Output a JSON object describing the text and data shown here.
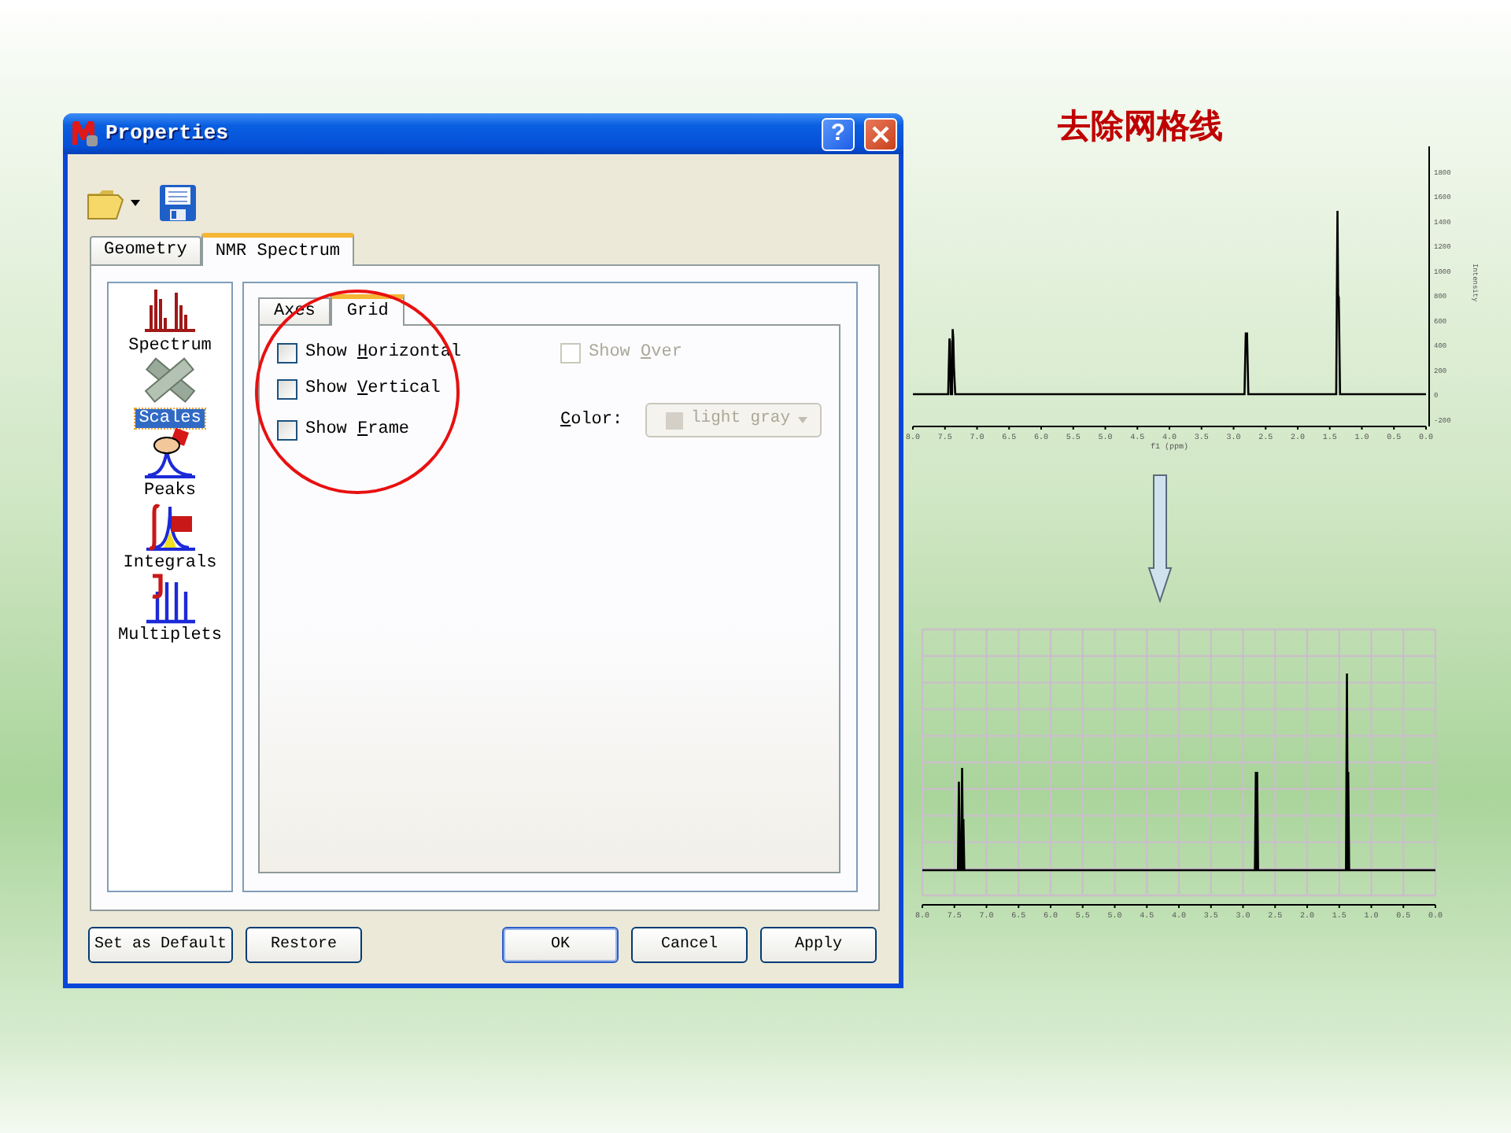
{
  "slide_title": "去除网格线",
  "dialog": {
    "title": "Properties",
    "help_label": "?",
    "tabs": [
      {
        "label": "Geometry",
        "selected": false
      },
      {
        "label": "NMR Spectrum",
        "selected": true
      }
    ],
    "categories": [
      {
        "label": "Spectrum",
        "kind": "spectrum",
        "selected": false
      },
      {
        "label": "Scales",
        "kind": "scales",
        "selected": true
      },
      {
        "label": "Peaks",
        "kind": "peaks",
        "selected": false
      },
      {
        "label": "Integrals",
        "kind": "integrals",
        "selected": false
      },
      {
        "label": "Multiplets",
        "kind": "multiplets",
        "selected": false
      }
    ],
    "subtabs": [
      {
        "label": "Axes",
        "selected": false
      },
      {
        "label": "Grid",
        "selected": true
      }
    ],
    "grid_options": [
      {
        "before": "Show ",
        "key": "H",
        "after": "orizontal",
        "checked": false,
        "disabled": false
      },
      {
        "before": "Show ",
        "key": "V",
        "after": "ertical",
        "checked": false,
        "disabled": false
      },
      {
        "before": "Show ",
        "key": "F",
        "after": "rame",
        "checked": false,
        "disabled": false
      }
    ],
    "over_option": {
      "before": "Show ",
      "key": "O",
      "after": "ver",
      "checked": false,
      "disabled": true
    },
    "color_field": {
      "key": "C",
      "after": "olor:",
      "value": "light gray",
      "disabled": true
    },
    "left_buttons": [
      {
        "label": "Set as Default",
        "default": false
      },
      {
        "label": "Restore",
        "default": false
      }
    ],
    "right_buttons": [
      {
        "label": "OK",
        "default": true
      },
      {
        "label": "Cancel",
        "default": false
      },
      {
        "label": "Apply",
        "default": false
      }
    ]
  },
  "spectrum_before": {
    "grid": false,
    "chart_data": {
      "type": "line",
      "xlabel": "f1 (ppm)",
      "ylabel": "Intensity",
      "x": [
        8.0,
        7.45,
        7.43,
        7.42,
        7.41,
        7.39,
        7.38,
        7.37,
        7.36,
        7.34,
        2.83,
        2.81,
        2.8,
        2.79,
        2.77,
        1.4,
        1.39,
        1.38,
        1.37,
        1.36,
        1.34,
        0.0
      ],
      "series": [
        {
          "color": "#000000",
          "values": [
            0,
            0,
            450,
            420,
            0,
            0,
            525,
            450,
            220,
            0,
            0,
            490,
            490,
            490,
            0,
            0,
            800,
            1480,
            800,
            780,
            0,
            0
          ]
        }
      ],
      "xlim": [
        8.0,
        0.0
      ],
      "ylim": [
        -260,
        2000
      ],
      "xticks": [
        {
          "value": 8.0,
          "label": "8.0"
        },
        {
          "value": 7.5,
          "label": "7.5"
        },
        {
          "value": 7.0,
          "label": "7.0"
        },
        {
          "value": 6.5,
          "label": "6.5"
        },
        {
          "value": 6.0,
          "label": "6.0"
        },
        {
          "value": 5.5,
          "label": "5.5"
        },
        {
          "value": 5.0,
          "label": "5.0"
        },
        {
          "value": 4.5,
          "label": "4.5"
        },
        {
          "value": 4.0,
          "label": "4.0"
        },
        {
          "value": 3.5,
          "label": "3.5"
        },
        {
          "value": 3.0,
          "label": "3.0"
        },
        {
          "value": 2.5,
          "label": "2.5"
        },
        {
          "value": 2.0,
          "label": "2.0"
        },
        {
          "value": 1.5,
          "label": "1.5"
        },
        {
          "value": 1.0,
          "label": "1.0"
        },
        {
          "value": 0.5,
          "label": "0.5"
        },
        {
          "value": 0.0,
          "label": "0.0"
        }
      ],
      "yticks": [
        1800,
        1600,
        1400,
        1200,
        1000,
        800,
        600,
        400,
        200,
        0,
        -200
      ]
    }
  },
  "spectrum_after": {
    "grid": true,
    "xticks": [
      "8.0",
      "7.5",
      "7.0",
      "6.5",
      "6.0",
      "5.5",
      "5.0",
      "4.5",
      "4.0",
      "3.5",
      "3.0",
      "2.5",
      "2.0",
      "1.5",
      "1.0",
      "0.5",
      "0.0"
    ]
  }
}
